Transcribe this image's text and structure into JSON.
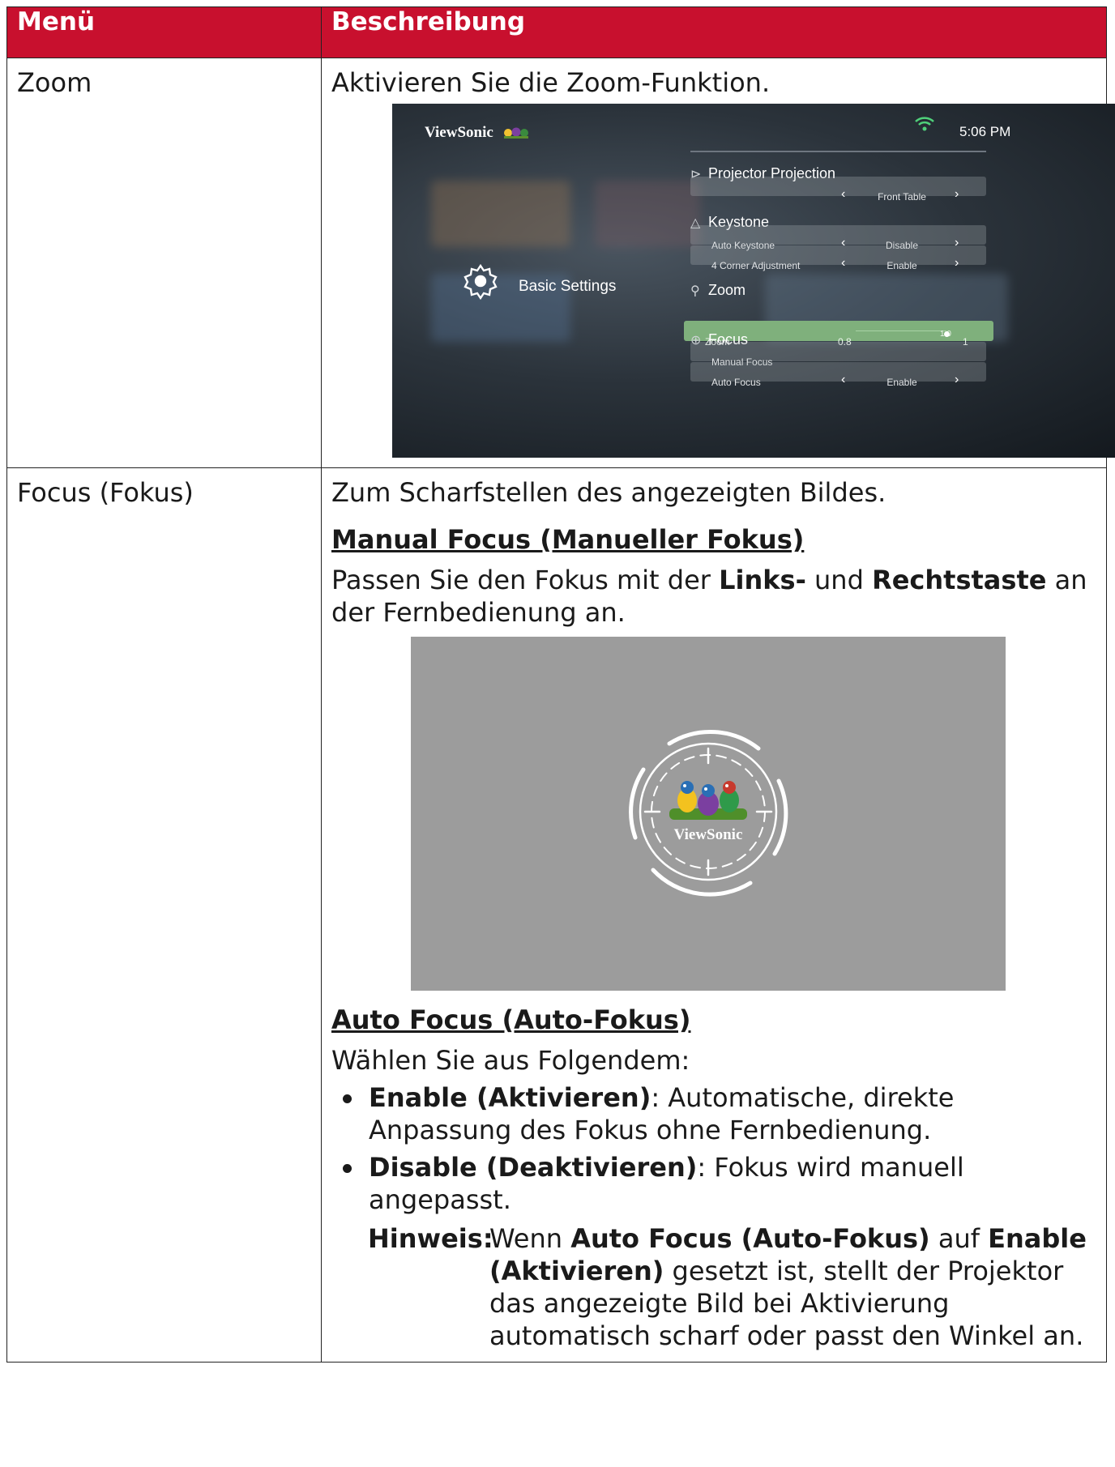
{
  "table": {
    "header": {
      "menu": "Menü",
      "description": "Beschreibung"
    },
    "zoom_row": {
      "menu": "Zoom",
      "description": "Aktivieren Sie die Zoom-Funktion."
    },
    "focus_row": {
      "menu": "Focus (Fokus)",
      "description": "Zum Scharfstellen des angezeigten Bildes.",
      "manual_heading": "Manual Focus (Manueller Fokus)",
      "manual_text_1": "Passen Sie den Fokus mit der ",
      "manual_bold_1": "Links-",
      "manual_text_2": " und ",
      "manual_bold_2": "Rechtstaste",
      "manual_text_3": " an der Fernbedienung an.",
      "auto_heading": "Auto Focus (Auto-Fokus)",
      "auto_intro": "Wählen Sie aus Folgendem:",
      "options": [
        {
          "label": "Enable (Aktivieren)",
          "text": ": Automatische, direkte Anpassung des Fokus ohne Fernbedienung."
        },
        {
          "label": "Disable (Deaktivieren)",
          "text": ": Fokus wird manuell angepasst."
        }
      ],
      "note_label": "Hinweis:",
      "note_text_1": "Wenn ",
      "note_bold_1": "Auto Focus (Auto-Fokus)",
      "note_text_2": " auf ",
      "note_bold_2": "Enable (Aktivieren)",
      "note_text_3": " gesetzt ist, stellt der Projektor das angezeigte Bild bei Aktivierung automatisch scharf oder passt den Winkel an."
    }
  },
  "screenshot": {
    "brand": "ViewSonic",
    "time": "5:06 PM",
    "category": "Basic Settings",
    "sections": {
      "projection": "Projector Projection",
      "keystone": "Keystone",
      "zoom": "Zoom",
      "focus": "Focus"
    },
    "rows": {
      "projection_value": "Front Table",
      "auto_keystone_label": "Auto Keystone",
      "auto_keystone_value": "Disable",
      "corner_label": "4 Corner Adjustment",
      "corner_value": "Enable",
      "zoom_label": "Zoom",
      "zoom_min": "0.8",
      "zoom_current": "1.0",
      "zoom_max": "1",
      "zoom_level_fraction": 1.0,
      "manual_focus_label": "Manual Focus",
      "auto_focus_label": "Auto Focus",
      "auto_focus_value": "Enable"
    },
    "colors": {
      "highlight": "#7fb07c",
      "wifi": "#4fd07a",
      "header": "#c8102e"
    }
  },
  "focus_image": {
    "brand": "ViewSonic"
  }
}
